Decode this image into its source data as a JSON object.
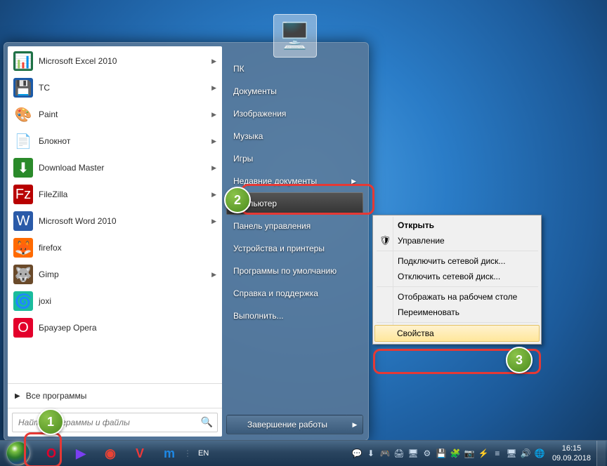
{
  "start_menu": {
    "programs": [
      {
        "label": "Microsoft Excel 2010",
        "icon": "📊",
        "bg": "#1e7145",
        "expand": true
      },
      {
        "label": "TC",
        "icon": "💾",
        "bg": "#1a5aa8",
        "expand": true
      },
      {
        "label": "Paint",
        "icon": "🎨",
        "bg": "#fff",
        "expand": true
      },
      {
        "label": "Блокнот",
        "icon": "📄",
        "bg": "#fff",
        "expand": true
      },
      {
        "label": "Download Master",
        "icon": "⬇",
        "bg": "#2a8a2a",
        "expand": true
      },
      {
        "label": "FileZilla",
        "icon": "Fz",
        "bg": "#b80000",
        "expand": true
      },
      {
        "label": "Microsoft Word 2010",
        "icon": "W",
        "bg": "#2a5aa8",
        "expand": true
      },
      {
        "label": "firefox",
        "icon": "🦊",
        "bg": "#ff6a00",
        "expand": false
      },
      {
        "label": "Gimp",
        "icon": "🐺",
        "bg": "#6a4a2a",
        "expand": true
      },
      {
        "label": "joxi",
        "icon": "🌀",
        "bg": "#1abc9c",
        "expand": false
      },
      {
        "label": "Браузер Opera",
        "icon": "O",
        "bg": "#e3002b",
        "expand": false
      }
    ],
    "all_programs": "Все программы",
    "search_placeholder": "Найти программы и файлы",
    "right_items": [
      {
        "label": "ПК"
      },
      {
        "label": "Документы"
      },
      {
        "label": "Изображения"
      },
      {
        "label": "Музыка"
      },
      {
        "label": "Игры"
      },
      {
        "label": "Недавние документы",
        "expand": true
      },
      {
        "label": "Компьютер",
        "highlighted": true
      },
      {
        "label": "Панель управления"
      },
      {
        "label": "Устройства и принтеры"
      },
      {
        "label": "Программы по умолчанию"
      },
      {
        "label": "Справка и поддержка"
      },
      {
        "label": "Выполнить..."
      }
    ],
    "shutdown": "Завершение работы"
  },
  "context_menu": {
    "items": [
      {
        "label": "Открыть",
        "bold": true
      },
      {
        "label": "Управление",
        "icon": "🛡"
      },
      {
        "sep": true
      },
      {
        "label": "Подключить сетевой диск..."
      },
      {
        "label": "Отключить сетевой диск..."
      },
      {
        "sep": true
      },
      {
        "label": "Отображать на рабочем столе"
      },
      {
        "label": "Переименовать"
      },
      {
        "sep": true
      },
      {
        "label": "Свойства",
        "highlighted": true
      }
    ]
  },
  "taskbar": {
    "pinned": [
      {
        "name": "opera",
        "glyph": "O",
        "color": "#e3002b"
      },
      {
        "name": "play",
        "glyph": "▶",
        "color": "#7b3ff2"
      },
      {
        "name": "chrome",
        "glyph": "◉",
        "color": "#ea4335"
      },
      {
        "name": "vivaldi",
        "glyph": "V",
        "color": "#ef3939"
      },
      {
        "name": "maxthon",
        "glyph": "m",
        "color": "#1e88e5"
      }
    ],
    "lang": "EN",
    "tray": [
      "💬",
      "⬇",
      "🎮",
      "🖨",
      "🖥",
      "⚙",
      "💾",
      "🧩",
      "📷",
      "⚡",
      "≡",
      "🖥",
      "🔊",
      "🌐"
    ],
    "time": "16:15",
    "date": "09.09.2018"
  },
  "callouts": {
    "n1": "1",
    "n2": "2",
    "n3": "3"
  }
}
